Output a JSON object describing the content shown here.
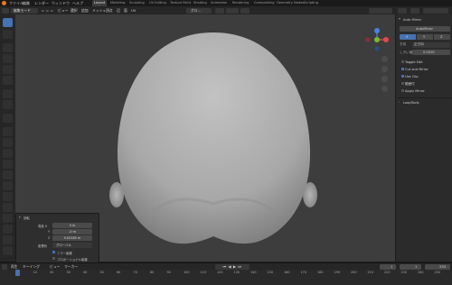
{
  "menubar": {
    "items": [
      "ファイル",
      "編集",
      "レンダー",
      "ウィンドウ",
      "ヘルプ"
    ],
    "workspaces": [
      "Layout",
      "Modeling",
      "Sculpting",
      "UV Editing",
      "Texture Paint",
      "Shading",
      "Animation",
      "Rendering",
      "Compositing",
      "Geometry Nodes",
      "Scripting"
    ],
    "active_workspace": "Layout"
  },
  "viewport_header": {
    "mode": "編集モード",
    "menus": [
      "ビュー",
      "選択",
      "追加",
      "メッシュ",
      "頂点",
      "辺",
      "面",
      "UV"
    ],
    "transform": "グロ..."
  },
  "npanel": {
    "section_title": "Auto Mirror",
    "button": "AutoMirror",
    "axes": [
      "X",
      "Y",
      "Z"
    ],
    "direction_label": "方向",
    "direction_value": "正方向",
    "threshold_label": "しきい値",
    "threshold_value": "0.0010",
    "toggle_edit": "Toggle Edit",
    "checks": [
      {
        "label": "Cut and Mirror",
        "on": true
      },
      {
        "label": "Use Clip",
        "on": true
      },
      {
        "label": "範囲付",
        "on": false
      },
      {
        "label": "Apply Mirror",
        "on": false
      }
    ],
    "looptools": "LoopTools"
  },
  "operator_panel": {
    "title": "回転",
    "rows": [
      {
        "label": "角度 X",
        "value": "0 m"
      },
      {
        "label": "Y",
        "value": "-0 m"
      },
      {
        "label": "Z",
        "value": "0.00185 m"
      }
    ],
    "orient_label": "座標系",
    "orient_value": "グローバル",
    "checks": [
      {
        "label": "ミラー編集",
        "on": true
      },
      {
        "label": "プロポーショナル編集",
        "on": false
      }
    ]
  },
  "timeline": {
    "menus": [
      "再生",
      "キーイング",
      "ビュー",
      "マーカー"
    ],
    "current_frame": "1",
    "start": "1",
    "end": "250",
    "ticks": [
      "0",
      "10",
      "20",
      "30",
      "40",
      "50",
      "60",
      "70",
      "80",
      "90",
      "100",
      "110",
      "120",
      "130",
      "140",
      "150",
      "160",
      "170",
      "180",
      "190",
      "200",
      "210",
      "220",
      "230",
      "240",
      "250"
    ]
  },
  "colors": {
    "accent": "#4772b3",
    "viewport": "#3d3d3d",
    "x_axis": "#e5474b",
    "y_axis": "#7ab82f",
    "z_axis": "#4a80e6"
  }
}
